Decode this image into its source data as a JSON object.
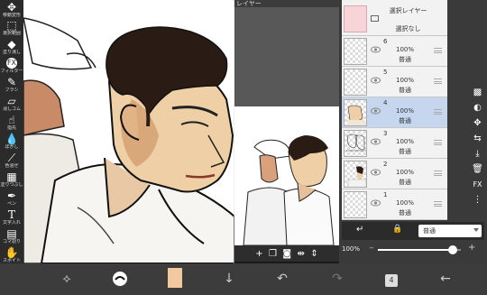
{
  "left_toolbar": {
    "tools": [
      {
        "icon": "move-arrows-icon",
        "label": "移動変形"
      },
      {
        "icon": "lasso-icon",
        "label": "選択範囲"
      },
      {
        "icon": "bucket-icon",
        "label": "塗り潰し"
      },
      {
        "icon": "fx-icon",
        "label": "フィルター"
      },
      {
        "icon": "brush-icon",
        "label": "ブラシ"
      },
      {
        "icon": "eraser-icon",
        "label": "消しゴム"
      },
      {
        "icon": "dropper-icon",
        "label": "指先"
      },
      {
        "icon": "blur-icon",
        "label": "ぼかし"
      },
      {
        "icon": "pen-icon",
        "label": "色混ぜ"
      },
      {
        "icon": "stamp-icon",
        "label": "塗りつぶし"
      },
      {
        "icon": "pen-nib-icon",
        "label": "ペン"
      },
      {
        "icon": "text-icon",
        "label": "文字入れ"
      },
      {
        "icon": "frame-icon",
        "label": "コマ割り"
      },
      {
        "icon": "hand-icon",
        "label": "スポイト"
      }
    ]
  },
  "reference": {
    "title": "レイヤー",
    "bar_icons": [
      "add-icon",
      "copy-icon",
      "camera-icon",
      "flip-h-icon",
      "flip-v-icon"
    ]
  },
  "layer_panel": {
    "selection_layer": {
      "title": "選択レイヤー",
      "subtitle": "選択なし"
    },
    "layers": [
      {
        "number": "6",
        "opacity": "100%",
        "blend": "普通",
        "selected": false
      },
      {
        "number": "5",
        "opacity": "100%",
        "blend": "普通",
        "selected": false
      },
      {
        "number": "4",
        "opacity": "100%",
        "blend": "普通",
        "selected": true
      },
      {
        "number": "3",
        "opacity": "100%",
        "blend": "普通",
        "selected": false
      },
      {
        "number": "2",
        "opacity": "100%",
        "blend": "普通",
        "selected": false
      },
      {
        "number": "1",
        "opacity": "100%",
        "blend": "普通",
        "selected": false
      }
    ],
    "side_buttons": [
      "checker-icon",
      "half-circle-icon",
      "move-icon",
      "flip-icon",
      "merge-down-icon",
      "trash-icon",
      "fx-icon",
      "more-icon"
    ],
    "fx_label": "FX",
    "blend_mode": "普通",
    "opacity_value": "100%",
    "opacity_level": 0.9
  },
  "bottom_bar": {
    "buttons": [
      "brush-settings-icon",
      "brush-icon",
      "color-swatch",
      "down-arrow-icon",
      "undo-icon",
      "redo-icon",
      "layers-count-icon",
      "back-icon"
    ],
    "layers_count": "4"
  },
  "colors": {
    "accent_selected": "#c5d6ee",
    "swatch": "#f2c8a0"
  }
}
